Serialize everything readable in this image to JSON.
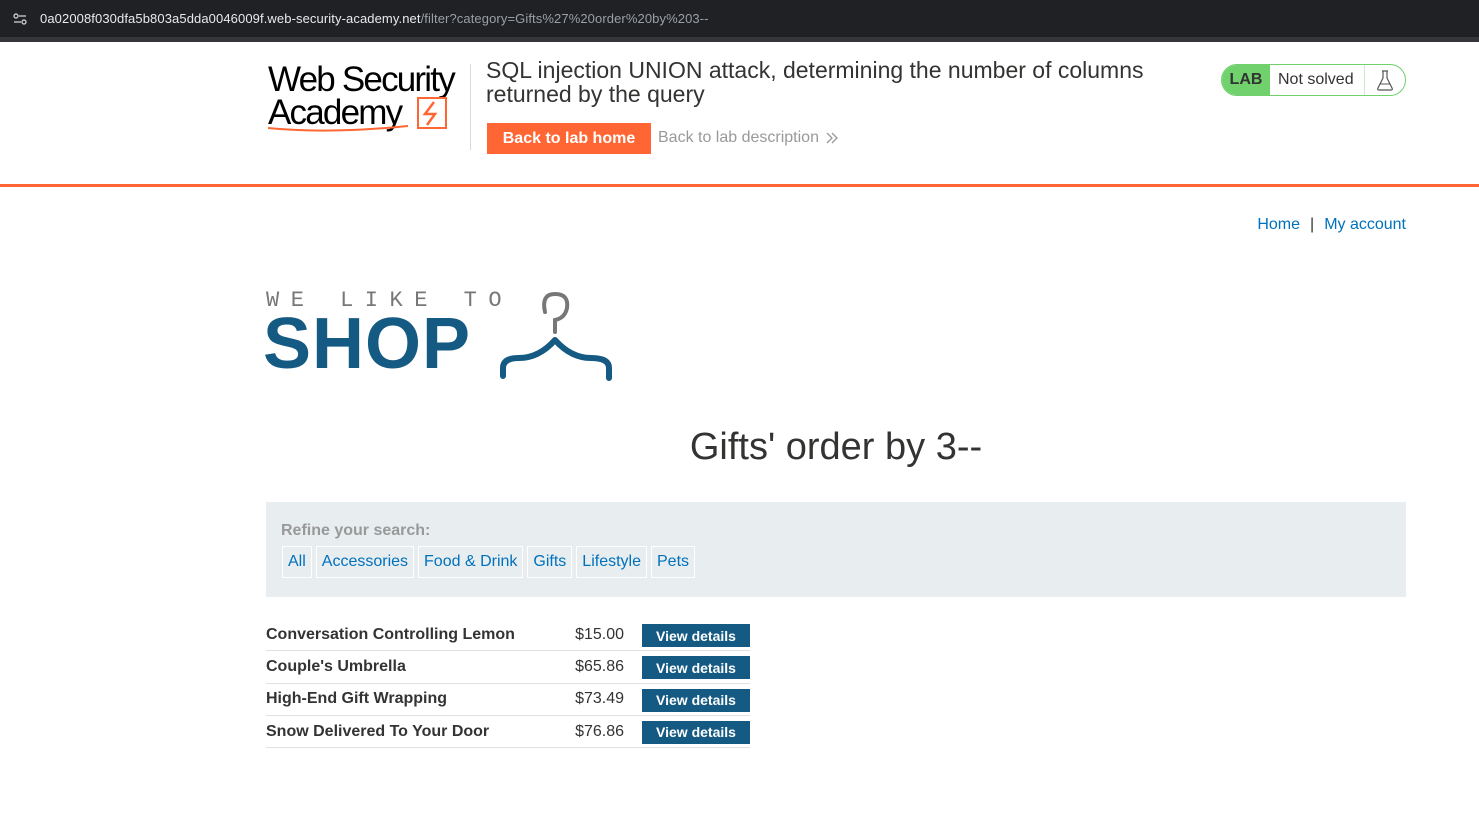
{
  "browser": {
    "url_host": "0a02008f030dfa5b803a5dda0046009f.web-security-academy.net",
    "url_path": "/filter?category=Gifts%27%20order%20by%203--",
    "site_icon": "tune-icon"
  },
  "lab_header": {
    "logo_line1": "Web Security",
    "logo_line2": "Academy",
    "title": "SQL injection UNION attack, determining the number of columns returned by the query",
    "back_home_label": "Back to lab home",
    "back_desc_label": "Back to lab description",
    "lab_badge": "LAB",
    "status": "Not solved",
    "accent_color": "#ff6633",
    "status_color": "#70d16d"
  },
  "nav": {
    "home": "Home",
    "separator": "|",
    "my_account": "My account"
  },
  "shop_logo": {
    "tagline": "WE LIKE TO",
    "word": "SHOP",
    "icon": "hanger-icon"
  },
  "page": {
    "heading": "Gifts' order by 3--"
  },
  "filters": {
    "label": "Refine your search:",
    "categories": [
      "All",
      "Accessories",
      "Food & Drink",
      "Gifts",
      "Lifestyle",
      "Pets"
    ]
  },
  "products": [
    {
      "name": "Conversation Controlling Lemon",
      "price": "$15.00",
      "action": "View details"
    },
    {
      "name": "Couple's Umbrella",
      "price": "$65.86",
      "action": "View details"
    },
    {
      "name": "High-End Gift Wrapping",
      "price": "$73.49",
      "action": "View details"
    },
    {
      "name": "Snow Delivered To Your Door",
      "price": "$76.86",
      "action": "View details"
    }
  ]
}
